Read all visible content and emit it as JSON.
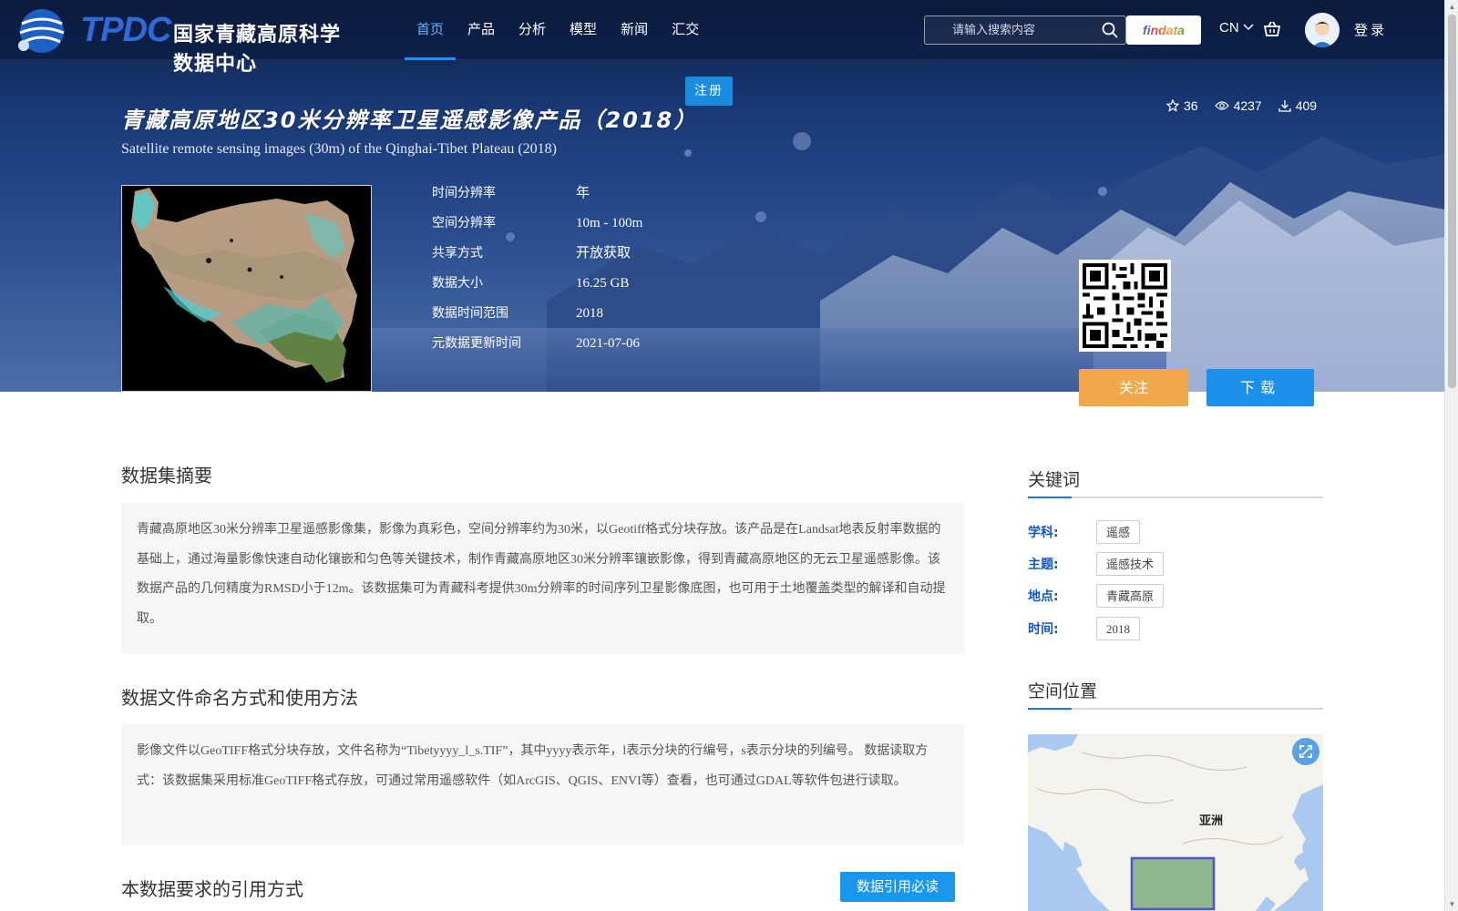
{
  "nav": {
    "logo_text": "TPDC",
    "site_name": "国家青藏高原科学数据中心",
    "menu": [
      {
        "label": "首页",
        "active": true
      },
      {
        "label": "产品",
        "active": false
      },
      {
        "label": "分析",
        "active": false
      },
      {
        "label": "模型",
        "active": false
      },
      {
        "label": "新闻",
        "active": false
      },
      {
        "label": "汇交",
        "active": false
      }
    ],
    "search_placeholder": "请输入搜索内容",
    "findata_label": "findata",
    "lang": "CN",
    "login_label": "登录",
    "register_label": "注册"
  },
  "dataset": {
    "title_cn": "青藏高原地区30米分辨率卫星遥感影像产品（2018）",
    "title_en": "Satellite remote sensing images (30m) of the Qinghai-Tibet Plateau (2018)",
    "stats": {
      "stars": "36",
      "views": "4237",
      "downloads": "409"
    },
    "meta": [
      {
        "key": "时间分辨率",
        "value": "年"
      },
      {
        "key": "空间分辨率",
        "value": "10m - 100m"
      },
      {
        "key": "共享方式",
        "value": "开放获取"
      },
      {
        "key": "数据大小",
        "value": "16.25 GB"
      },
      {
        "key": "数据时间范围",
        "value": "2018"
      },
      {
        "key": "元数据更新时间",
        "value": "2021-07-06"
      }
    ],
    "follow_label": "关注",
    "download_label": "下载"
  },
  "sections": {
    "abstract_title": "数据集摘要",
    "abstract_text": "青藏高原地区30米分辨率卫星遥感影像集，影像为真彩色，空间分辨率约为30米，以Geotiff格式分块存放。该产品是在Landsat地表反射率数据的基础上，通过海量影像快速自动化镶嵌和匀色等关键技术，制作青藏高原地区30米分辨率镶嵌影像，得到青藏高原地区的无云卫星遥感影像。该数据产品的几何精度为RMSD小于12m。该数据集可为青藏科考提供30m分辨率的时间序列卫星影像底图，也可用于土地覆盖类型的解译和自动提取。",
    "naming_title": "数据文件命名方式和使用方法",
    "naming_text": "影像文件以GeoTIFF格式分块存放，文件名称为“Tibetyyyy_l_s.TIF”，其中yyyy表示年，l表示分块的行编号，s表示分块的列编号。 数据读取方式：该数据集采用标准GeoTIFF格式存放，可通过常用遥感软件（如ArcGIS、QGIS、ENVI等）查看，也可通过GDAL等软件包进行读取。",
    "citation_title": "本数据要求的引用方式",
    "citation_button": "数据引用必读"
  },
  "sidebar": {
    "keywords_title": "关键词",
    "keywords": [
      {
        "label": "学科:",
        "tag": "遥感"
      },
      {
        "label": "主题:",
        "tag": "遥感技术"
      },
      {
        "label": "地点:",
        "tag": "青藏高原"
      },
      {
        "label": "时间:",
        "tag": "2018"
      }
    ],
    "location_title": "空间位置",
    "map_label": "亚洲"
  },
  "colors": {
    "accent": "#1a8fec",
    "follow": "#f0a84a",
    "keyword_label": "#1256c8"
  }
}
